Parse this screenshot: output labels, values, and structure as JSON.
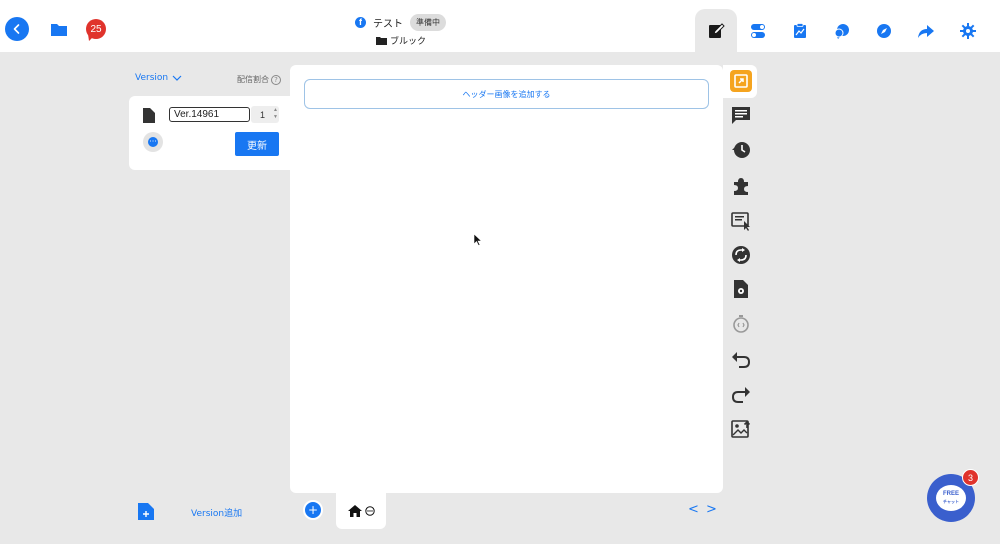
{
  "header": {
    "notification_count": "25",
    "page_title": "テスト",
    "status": "準備中",
    "folder_name": "ブルック"
  },
  "toolbar": {
    "tabs": [
      {
        "name": "edit",
        "icon": "edit-icon",
        "active": true
      },
      {
        "name": "toggle",
        "icon": "toggle-icon"
      },
      {
        "name": "analytics",
        "icon": "analytics-icon"
      },
      {
        "name": "chat",
        "icon": "chat-icon"
      },
      {
        "name": "compass",
        "icon": "compass-icon"
      },
      {
        "name": "share",
        "icon": "share-icon"
      },
      {
        "name": "settings",
        "icon": "gear-icon"
      }
    ]
  },
  "left_panel": {
    "version_label": "Version",
    "ratio_label": "配信割合",
    "help_symbol": "?",
    "version_name": "Ver.14961",
    "ratio_value": "1",
    "update_label": "更新"
  },
  "canvas": {
    "header_add_label": "ヘッダー画像を追加する"
  },
  "side_tools": [
    {
      "name": "highlight",
      "icon": "image-pick-icon"
    },
    {
      "name": "comment",
      "icon": "comment-icon"
    },
    {
      "name": "history",
      "icon": "history-icon"
    },
    {
      "name": "plugin",
      "icon": "puzzle-icon"
    },
    {
      "name": "select",
      "icon": "select-text-icon"
    },
    {
      "name": "sync",
      "icon": "sync-icon"
    },
    {
      "name": "doc-settings",
      "icon": "doc-settings-icon"
    },
    {
      "name": "timer",
      "icon": "timer-icon"
    },
    {
      "name": "undo",
      "icon": "undo-icon"
    },
    {
      "name": "redo",
      "icon": "redo-icon"
    },
    {
      "name": "image-upload",
      "icon": "image-upload-icon"
    }
  ],
  "bottom": {
    "add_version_label": "Version追加",
    "add_page_symbol": "+",
    "nav_prev": "<",
    "nav_next": ">"
  },
  "chat_widget": {
    "line1": "FREE",
    "line2": "チャット",
    "badge": "3"
  },
  "colors": {
    "accent": "#1877f2",
    "highlight": "#f5a41f",
    "badge": "#e0332c",
    "chat": "#3a5fcd"
  }
}
